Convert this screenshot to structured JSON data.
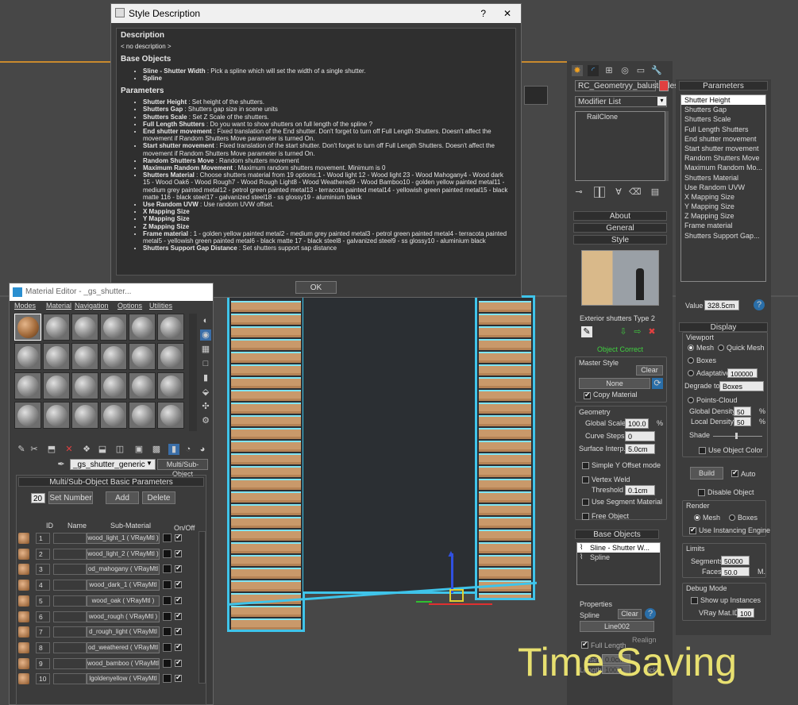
{
  "dialog": {
    "title": "Style Description",
    "help_label": "?",
    "close_label": "✕",
    "heading_description": "Description",
    "no_description": "< no description >",
    "heading_base_objects": "Base Objects",
    "base_objects": [
      {
        "name": "Sline - Shutter Width",
        "desc": " : Pick a spline which will set the width of a single shutter."
      },
      {
        "name": "Spline",
        "desc": ""
      }
    ],
    "heading_parameters": "Parameters",
    "parameters": [
      {
        "name": "Shutter Height",
        "desc": " : Set height of the shutters."
      },
      {
        "name": "Shutters Gap",
        "desc": " : Shutters gap size in scene units"
      },
      {
        "name": "Shutters Scale",
        "desc": " : Set Z Scale of the shutters."
      },
      {
        "name": "Full Length Shutters",
        "desc": " : Do you want to show shutters on full length of the spline ?"
      },
      {
        "name": "End shutter movement",
        "desc": " : Fixed translation of the End shutter. Don't forget to turn off Full Length Shutters. Doesn't affect the movement if Random Shutters Move parameter is turned On."
      },
      {
        "name": "Start shutter movement",
        "desc": " : Fixed translation of the start shutter. Don't forget to turn off Full Length Shutters. Doesn't affect the movement if Random Shutters Move parameter is turned On."
      },
      {
        "name": "Random Shutters Move",
        "desc": " : Random shutters movement"
      },
      {
        "name": "Maximum Random Movement",
        "desc": " : Maximum random shutters movement. Minimum is 0"
      },
      {
        "name": "Shutters Material",
        "desc": " : Choose shutters material from  19 options:1 - Wood light 12 - Wood light 23 - Wood Mahogany4 - Wood dark 15 - Wood Oak6 - Wood Rough7 - Wood Rough Light8 - Wood Weathered9 - Wood Bamboo10 - golden yellow painted metal11 - medium grey painted metal12 - petrol green painted metal13 - terracota painted metal14 - yellowish green painted metal15 - black matte 116 - black steel17 - galvanized steel18 - ss glossy19 - aluminium black"
      },
      {
        "name": "Use Random UVW",
        "desc": " : Use random UVW offset."
      },
      {
        "name": "X Mapping Size",
        "desc": ""
      },
      {
        "name": "Y Mapping Size",
        "desc": ""
      },
      {
        "name": "Z Mapping Size",
        "desc": ""
      },
      {
        "name": "Frame material",
        "desc": " : 1 - golden yellow painted metal2 - medium grey painted metal3 - petrol green painted metal4 - terracota painted metal5 - yellowish green painted metal6 - black matte  17 - black steel8 - galvanized steel9 - ss glossy10 - aluminium black"
      },
      {
        "name": "Shutters Support Gap Distance",
        "desc": " : Set shutters support sap distance"
      }
    ],
    "ok_label": "OK"
  },
  "material_editor": {
    "title": "Material Editor - _gs_shutter...",
    "menu": [
      "Modes",
      "Material",
      "Navigation",
      "Options",
      "Utilities"
    ],
    "material_name": "_gs_shutter_generic",
    "material_type": "Multi/Sub-Object",
    "rollout_title": "Multi/Sub-Object Basic Parameters",
    "set_number_value": "20",
    "set_number_label": "Set Number",
    "add_label": "Add",
    "delete_label": "Delete",
    "col_id": "ID",
    "col_name": "Name",
    "col_submaterial": "Sub-Material",
    "col_onoff": "On/Off",
    "rows": [
      {
        "id": "1",
        "sub": "wood_light_1  ( VRayMtl )"
      },
      {
        "id": "2",
        "sub": "wood_light_2  ( VRayMtl )"
      },
      {
        "id": "3",
        "sub": "od_mahogany  ( VRayMtl )"
      },
      {
        "id": "4",
        "sub": "wood_dark_1  ( VRayMtl )"
      },
      {
        "id": "5",
        "sub": "wood_oak  ( VRayMtl )"
      },
      {
        "id": "6",
        "sub": "wood_rough  ( VRayMtl )"
      },
      {
        "id": "7",
        "sub": "d_rough_light  ( VRayMtl )"
      },
      {
        "id": "8",
        "sub": "od_weathered  ( VRayMtl )"
      },
      {
        "id": "9",
        "sub": "wood_bamboo  ( VRayMtl )"
      },
      {
        "id": "10",
        "sub": "lgoldenyellow  ( VRayMtl )"
      }
    ]
  },
  "command_panel": {
    "object_name": "RC_Geometryy_balustrades",
    "object_color": "#e04040",
    "modifier_list": "Modifier List",
    "stack_item": "RailClone",
    "about": "About",
    "general": "General",
    "style": "Style",
    "style_name": "Exterior shutters Type 2",
    "object_status": "Object Correct",
    "master_style": "Master Style",
    "clear": "Clear",
    "none": "None",
    "copy_material": "Copy Material",
    "geometry": "Geometry",
    "global_scale_label": "Global Scale",
    "global_scale": "100.0",
    "pct": "%",
    "curve_steps_label": "Curve Steps",
    "curve_steps": "0",
    "surface_interp_label": "Surface Interp.",
    "surface_interp": "5.0cm",
    "simple_y_offset": "Simple Y Offset mode",
    "vertex_weld": "Vertex Weld",
    "threshold_label": "Threshold",
    "threshold": "0.1cm",
    "use_segment_material": "Use Segment Material",
    "free_object": "Free Object",
    "base_objects": "Base Objects",
    "base_list": [
      "Sline - Shutter W...",
      "Spline"
    ],
    "properties": "Properties",
    "spline_label": "Spline",
    "line_name": "Line002",
    "full_length": "Full Length",
    "realign": "Realign",
    "start_label": "Start",
    "start_value": "0.0cm",
    "length_label": "Length",
    "length_value": "100.0",
    "pick": "Pick"
  },
  "params_panel": {
    "title": "Parameters",
    "items": [
      "Shutter Height",
      "Shutters Gap",
      "Shutters Scale",
      "Full Length Shutters",
      "End shutter movement",
      "Start shutter movement",
      "Random Shutters Move",
      "Maximum Random Mo...",
      "Shutters Material",
      "Use Random UVW",
      "X Mapping Size",
      "Y Mapping Size",
      "Z Mapping Size",
      "Frame material",
      "Shutters Support Gap..."
    ],
    "value_label": "Value",
    "value": "328.5cm",
    "display": "Display",
    "viewport": "Viewport",
    "mesh": "Mesh",
    "quick_mesh": "Quick Mesh",
    "boxes": "Boxes",
    "adaptative": "Adaptative",
    "adaptative_value": "100000",
    "degrade_to": "Degrade to",
    "degrade_value": "Boxes",
    "points_cloud": "Points-Cloud",
    "global_density_label": "Global Density",
    "global_density": "50",
    "local_density_label": "Local Density",
    "local_density": "50",
    "shade": "Shade",
    "use_object_color": "Use Object Color",
    "build": "Build",
    "auto": "Auto",
    "disable_object": "Disable Object",
    "render": "Render",
    "render_mesh": "Mesh",
    "render_boxes": "Boxes",
    "use_instancing": "Use Instancing Engine",
    "limits": "Limits",
    "segments_label": "Segments",
    "segments": "50000",
    "faces_label": "Faces",
    "faces": "50.0",
    "faces_unit": "M.",
    "debug_mode": "Debug Mode",
    "show_instances": "Show up Instances",
    "vray_mat_label": "VRay Mat.ID",
    "vray_mat": "100"
  },
  "overlay": {
    "caption": "Time Saving",
    "caption_color": "#e8e070"
  }
}
